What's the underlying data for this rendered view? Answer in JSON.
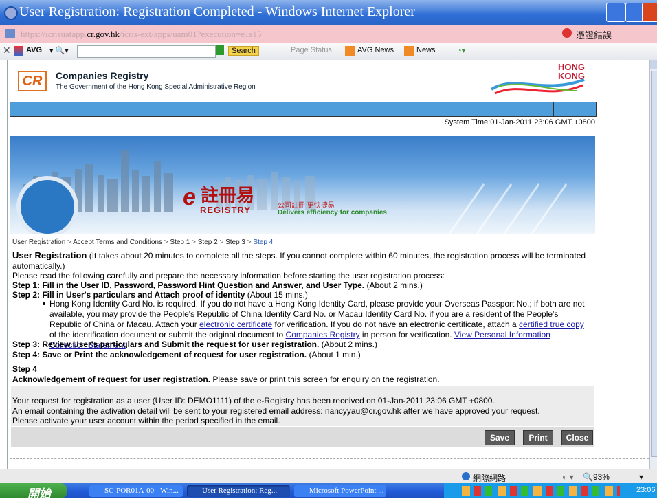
{
  "window": {
    "title": "User Registration: Registration Completed - Windows Internet Explorer"
  },
  "address": {
    "url_prefix": "https://icrisuatapp.",
    "url_domain": "cr.gov.hk",
    "url_suffix": "/icris-ext/apps/uam01?execution=e1s15",
    "cert_error": "憑證錯誤"
  },
  "toolbar": {
    "avg": "AVG",
    "search": "Search",
    "page_status": "Page Status",
    "avg_news": "AVG News",
    "news": "News"
  },
  "header": {
    "org_name": "Companies Registry",
    "org_sub": "The Government of the Hong Kong Special Administrative Region",
    "hk_logo": "HONG KONG",
    "system_time": "System Time:01-Jan-2011 23:06 GMT +0800"
  },
  "banner": {
    "zh": "註冊易",
    "registry": "REGISTRY",
    "tagline_zh": "公司註冊 更快捷易",
    "tagline_en": "Delivers efficiency for companies"
  },
  "breadcrumb": [
    "User Registration",
    "Accept Terms and Conditions",
    "Step 1",
    "Step 2",
    "Step 3",
    "Step 4"
  ],
  "intro": {
    "heading": "User Registration",
    "heading_note": " (It takes about 20 minutes to complete all the steps. If you cannot complete within 60 minutes, the registration process will be terminated automatically.)",
    "read_note": "Please read the following carefully and prepare the necessary information before starting the user registration process:",
    "step1_bold": "Step 1: Fill in the User ID, Password, Password Hint Question and Answer, and User Type.",
    "step1_time": " (About 2 mins.)",
    "step2_bold": "Step 2: Fill in User's particulars and Attach proof of identity",
    "step2_time": " (About 15 mins.)",
    "bullet_a": "Hong Kong Identity Card No. is required. If you do not have a Hong Kong Identity Card, please provide your Overseas Passport No.; if both are not available, you may provide the People's Republic of China Identity Card No. or Macau Identity Card No. if you are a resident of the People's Republic of China or Macau. Attach your ",
    "link_cert": "electronic certificate",
    "bullet_b": " for verification. If you do not have an electronic certificate, attach a ",
    "link_copy": "certified true copy",
    "bullet_c": " of the identification document or submit the original document to ",
    "link_cr": "Companies Registry",
    "bullet_d": " in person for verification. ",
    "link_pics": "View Personal Information Collection Statement",
    "bullet_e": ".",
    "step3_bold": "Step 3: Review User's particulars and Submit the request for user registration.",
    "step3_time": " (About 2 mins.)",
    "step4_bold": "Step 4: Save or Print the acknowledgement of request for user registration.",
    "step4_time": " (About 1 min.)"
  },
  "step4": {
    "title": "Step 4",
    "ack_bold": "Acknowledgement of request for user registration.",
    "ack_rest": " Please save or print this screen for enquiry on the registration.",
    "msg1": "Your request for registration as a user (User ID: DEMO1111) of the e-Registry has been received on 01-Jan-2011 23:06 GMT +0800.",
    "msg2": "An email containing the activation detail will be sent to your registered email address: nancyyau@cr.gov.hk after we have approved your request.",
    "msg3": "Please activate your user account within the period specified in the email."
  },
  "buttons": {
    "save": "Save",
    "print": "Print",
    "close": "Close"
  },
  "statusbar": {
    "zone": "網際網路",
    "zoom": "93%"
  },
  "taskbar": {
    "start": "開始",
    "task1": "SC-POR01A-00 - Win...",
    "task2": "User Registration: Reg...",
    "task3": "Microsoft PowerPoint ...",
    "clock": "23:06"
  }
}
